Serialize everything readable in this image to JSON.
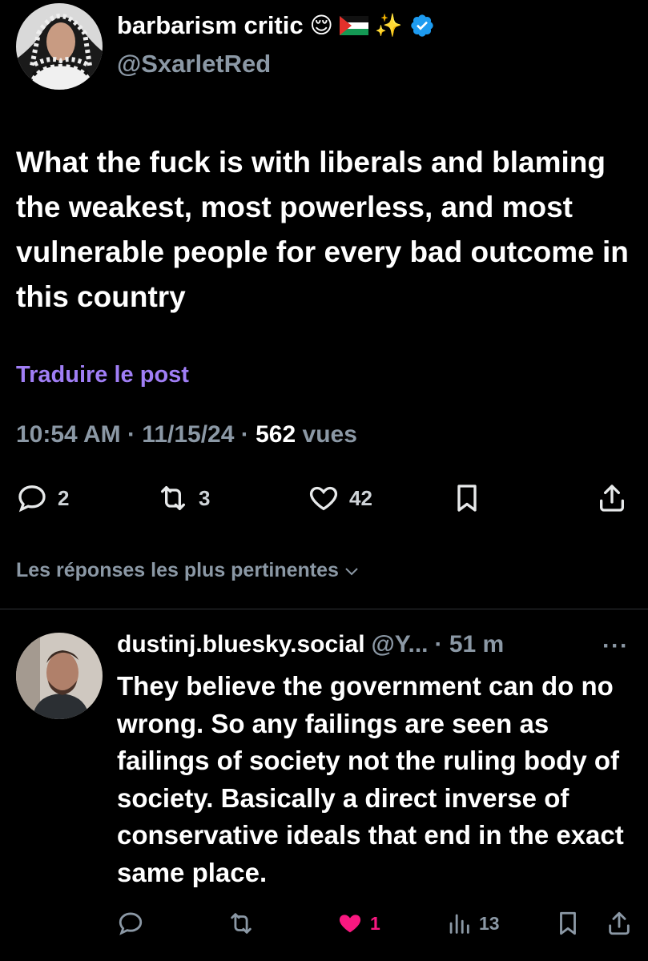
{
  "post": {
    "author_name": "barbarism critic",
    "author_handle": "@SxarletRed",
    "emojis": [
      "😌",
      "✨"
    ],
    "text": "What the fuck is with liberals and blaming the weakest, most powerless, and most vulnerable people for every bad outcome in this country",
    "translate_label": "Traduire le post",
    "time": "10:54 AM",
    "date": "11/15/24",
    "views_count": "562",
    "views_label": "vues",
    "separator": "·",
    "actions": {
      "replies": "2",
      "reposts": "3",
      "likes": "42"
    }
  },
  "sort_label": "Les réponses les plus pertinentes",
  "reply": {
    "author_name": "dustinj.bluesky.social",
    "author_handle": "@Y...",
    "age": "· 51 m",
    "more": "···",
    "text": "They believe the government can do no wrong. So any failings are seen as failings of society not the ruling body of society. Basically a direct inverse of conservative ideals that end in the exact same place.",
    "actions": {
      "likes": "1",
      "views": "13"
    }
  },
  "colors": {
    "background": "#000000",
    "text": "#e7e9ea",
    "muted": "#8b98a5",
    "translate": "#a07ef5",
    "verified": "#1d9bf0",
    "like_active": "#f91880"
  },
  "icons": [
    "reply-icon",
    "repost-icon",
    "like-icon",
    "bookmark-icon",
    "share-icon",
    "views-icon",
    "verified-icon",
    "chevron-down-icon",
    "more-icon"
  ]
}
